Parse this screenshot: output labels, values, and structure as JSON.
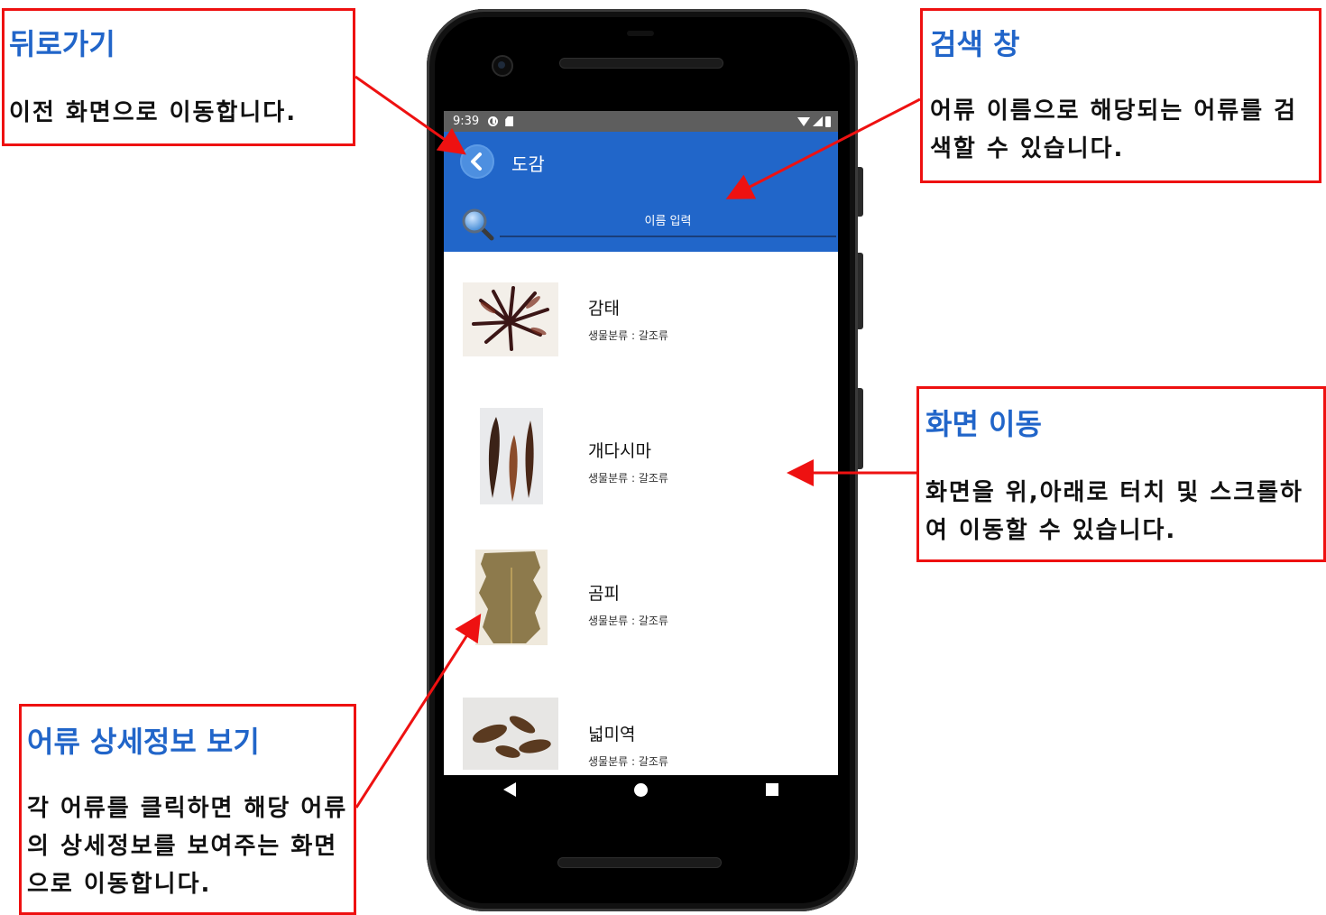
{
  "status_bar": {
    "time": "9:39"
  },
  "app": {
    "title": "도감",
    "search": {
      "placeholder": "이름 입력",
      "value": ""
    }
  },
  "items": [
    {
      "name": "감태",
      "classification": "생물분류 : 갈조류"
    },
    {
      "name": "개다시마",
      "classification": "생물분류 : 갈조류"
    },
    {
      "name": "곰피",
      "classification": "생물분류 : 갈조류"
    },
    {
      "name": "넓미역",
      "classification": "생물분류 : 갈조류"
    }
  ],
  "annotations": {
    "back": {
      "title": "뒤로가기",
      "desc": "이전 화면으로 이동합니다."
    },
    "search": {
      "title": "검색 창",
      "desc": "어류 이름으로 해당되는 어류를 검색할 수 있습니다."
    },
    "scroll": {
      "title": "화면 이동",
      "desc": "화면을 위,아래로 터치 및 스크롤하여 이동할 수 있습니다."
    },
    "detail": {
      "title": "어류 상세정보 보기",
      "desc": "각 어류를 클릭하면 해당 어류의 상세정보를 보여주는 화면으로 이동합니다."
    }
  },
  "colors": {
    "appbar": "#2166c9",
    "annotation_border": "#ee1111",
    "annotation_title": "#2165c9"
  }
}
